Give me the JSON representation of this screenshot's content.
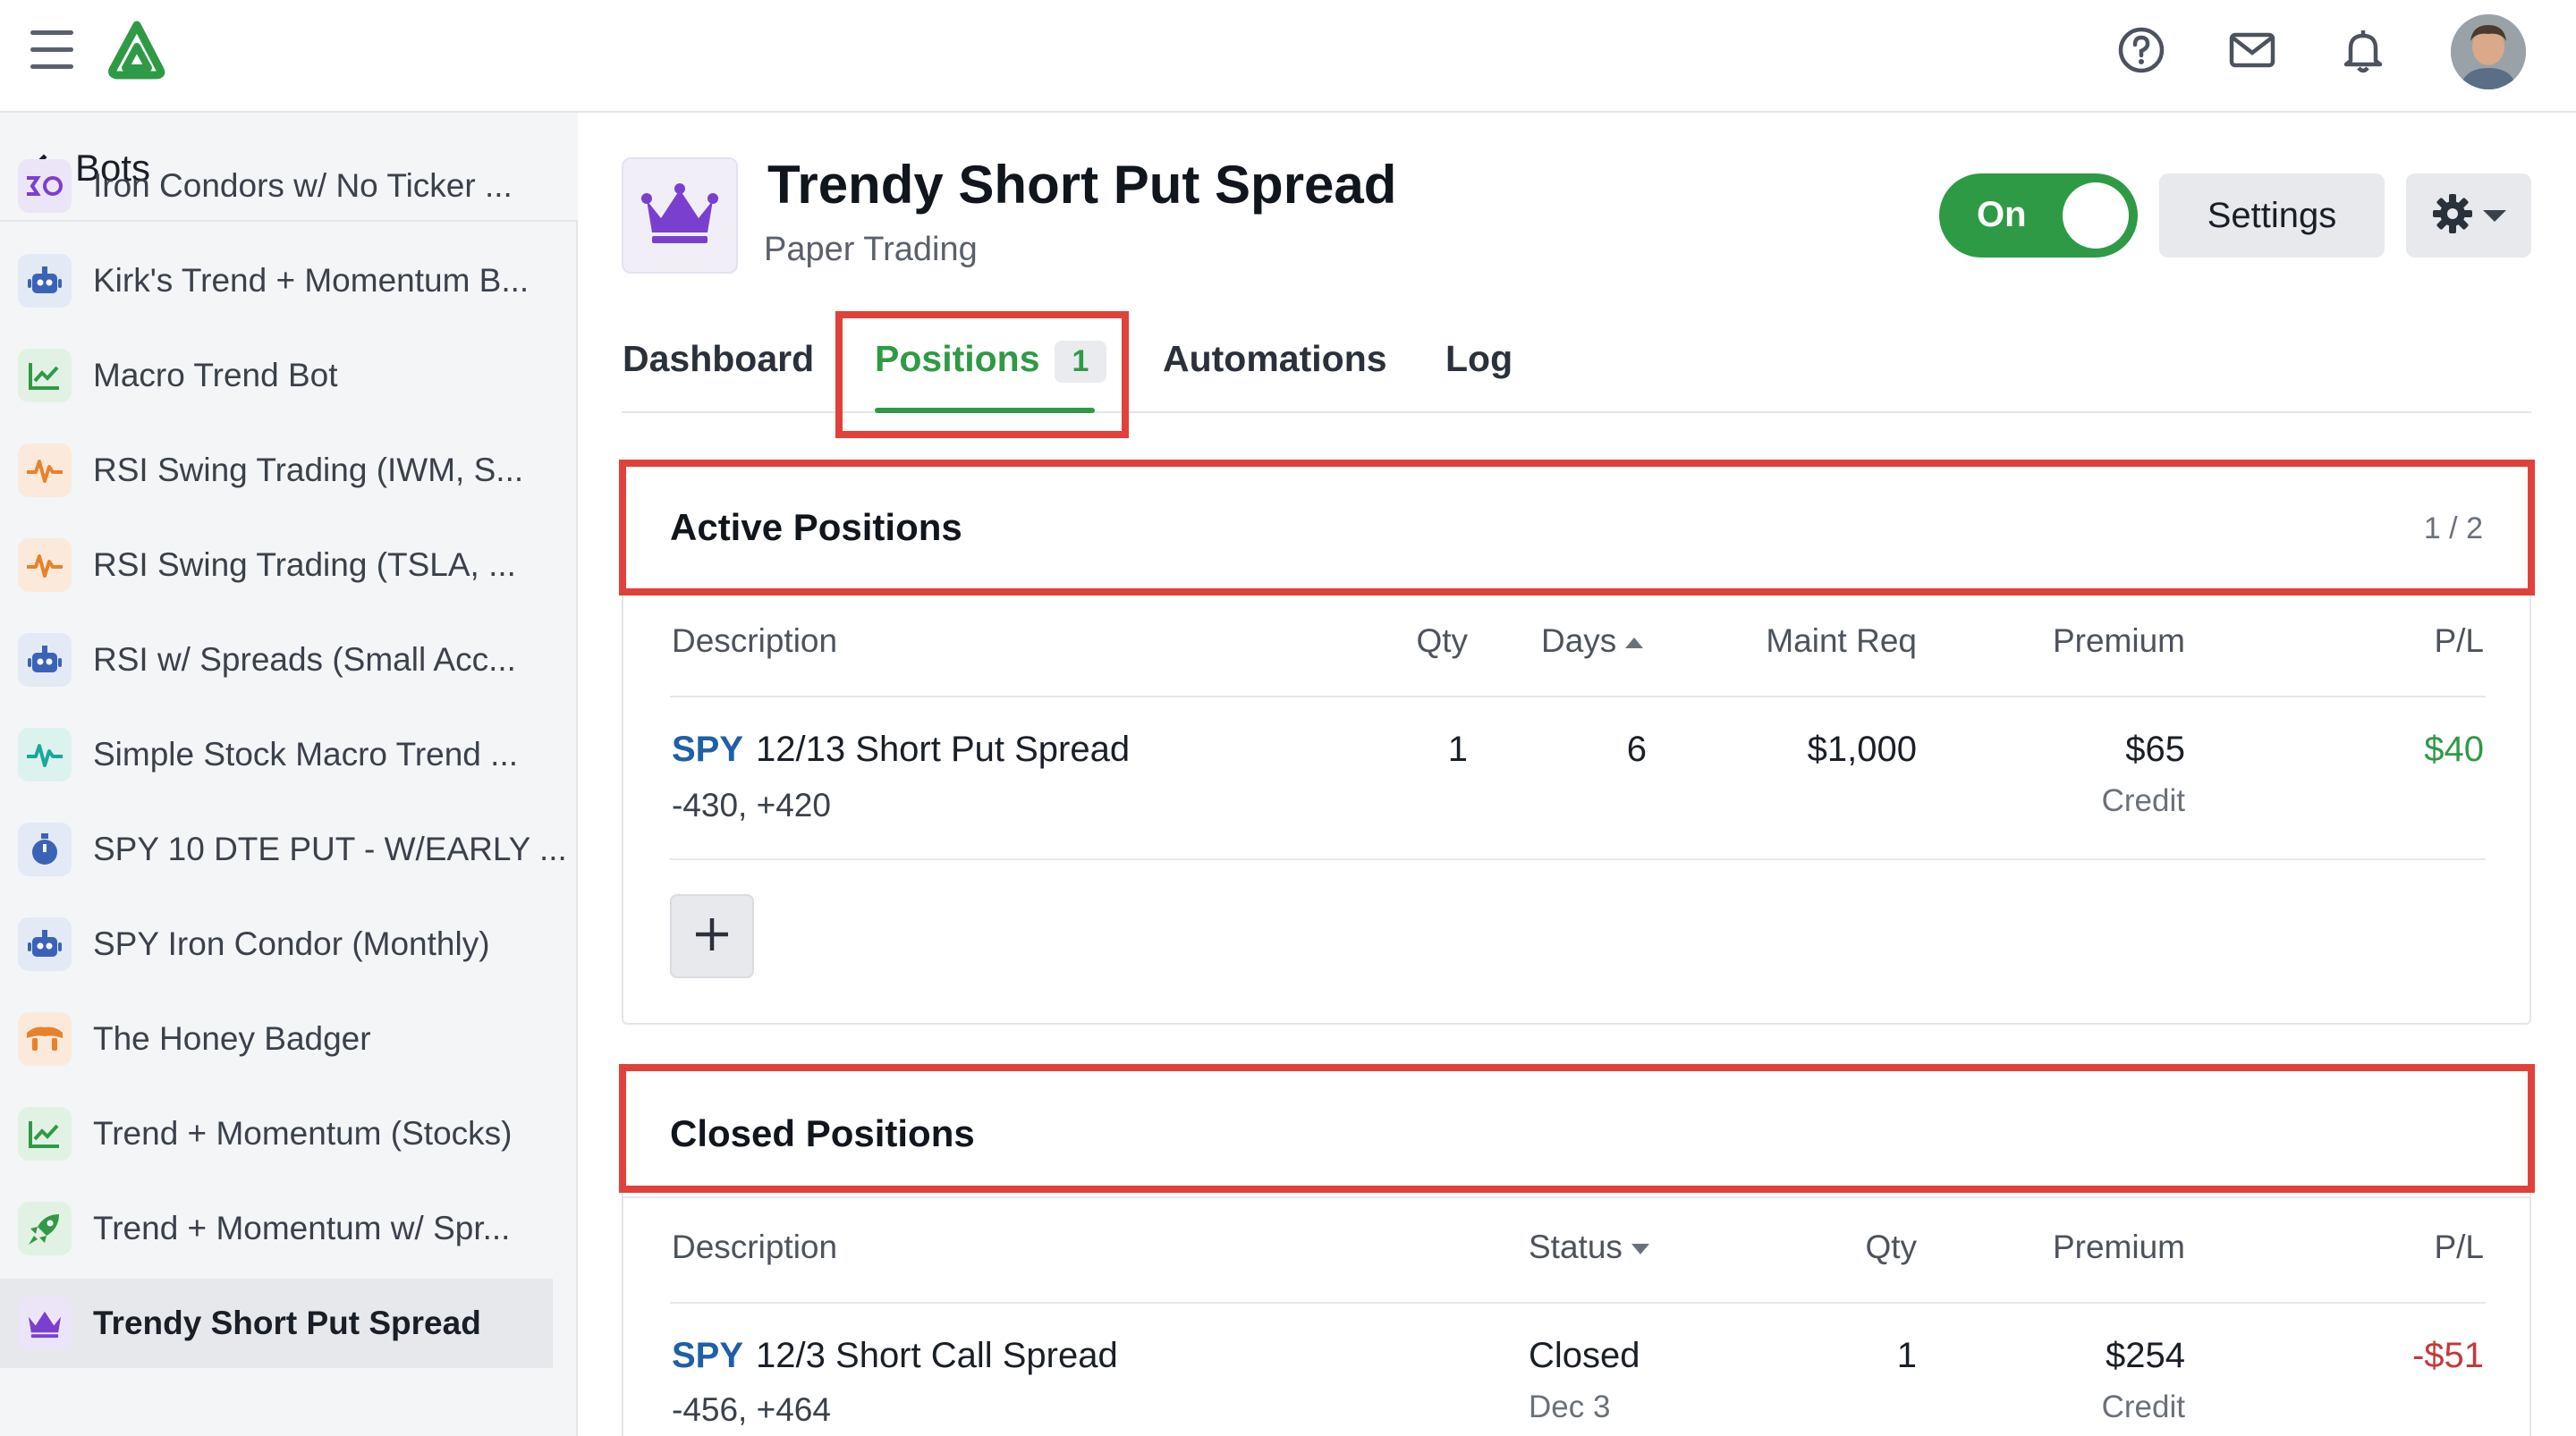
{
  "topbar": {
    "menu_icon": "hamburger-icon",
    "logo_icon": "brand-logo-icon",
    "icons": [
      "help-circle-icon",
      "mail-icon",
      "bell-icon"
    ],
    "avatar_icon": "user-avatar"
  },
  "sidebar": {
    "back_label": "Bots",
    "items": [
      {
        "label": "Iron Condors w/ No Ticker ...",
        "icon": "iron-condor-icon",
        "color": "#7b3fd0"
      },
      {
        "label": "Kirk's Trend + Momentum B...",
        "icon": "robot-icon",
        "color": "#3a63b8"
      },
      {
        "label": "Macro Trend Bot",
        "icon": "chart-line-icon",
        "color": "#2f9a45"
      },
      {
        "label": "RSI Swing Trading (IWM, S...",
        "icon": "pulse-icon",
        "color": "#e8822a"
      },
      {
        "label": "RSI Swing Trading (TSLA, ...",
        "icon": "pulse-icon",
        "color": "#e8822a"
      },
      {
        "label": "RSI w/ Spreads (Small Acc...",
        "icon": "robot-icon",
        "color": "#3a63b8"
      },
      {
        "label": "Simple Stock Macro Trend ...",
        "icon": "pulse-icon",
        "color": "#1aa89a"
      },
      {
        "label": "SPY 10 DTE PUT - W/EARLY ...",
        "icon": "stopwatch-icon",
        "color": "#3a63b8"
      },
      {
        "label": "SPY Iron Condor (Monthly)",
        "icon": "robot-icon",
        "color": "#3a63b8"
      },
      {
        "label": "The Honey Badger",
        "icon": "badger-icon",
        "color": "#e8822a"
      },
      {
        "label": "Trend + Momentum (Stocks)",
        "icon": "chart-line-icon",
        "color": "#2f9a45"
      },
      {
        "label": "Trend + Momentum w/ Spr...",
        "icon": "rocket-icon",
        "color": "#2f9a45"
      },
      {
        "label": "Trendy Short Put Spread",
        "icon": "crown-icon",
        "color": "#7b3fd0",
        "active": true
      }
    ]
  },
  "bot": {
    "title": "Trendy Short Put Spread",
    "subtitle": "Paper Trading",
    "icon": "crown-icon",
    "toggle_label": "On",
    "settings_label": "Settings",
    "gear_icon": "gear-icon"
  },
  "tabs": [
    {
      "label": "Dashboard"
    },
    {
      "label": "Positions",
      "badge": "1",
      "active": true
    },
    {
      "label": "Automations"
    },
    {
      "label": "Log"
    }
  ],
  "active_positions": {
    "title": "Active Positions",
    "count": "1 / 2",
    "columns": {
      "description": "Description",
      "qty": "Qty",
      "days": "Days",
      "maint_req": "Maint Req",
      "premium": "Premium",
      "pl": "P/L"
    },
    "rows": [
      {
        "ticker": "SPY",
        "desc": "12/13 Short Put Spread",
        "legs": "-430, +420",
        "qty": "1",
        "days": "6",
        "maint_req": "$1,000",
        "premium": "$65",
        "premium_type": "Credit",
        "pl": "$40"
      }
    ],
    "add_icon": "plus-icon"
  },
  "closed_positions": {
    "title": "Closed Positions",
    "columns": {
      "description": "Description",
      "status": "Status",
      "qty": "Qty",
      "premium": "Premium",
      "pl": "P/L"
    },
    "rows": [
      {
        "ticker": "SPY",
        "desc": "12/3 Short Call Spread",
        "legs": "-456, +464",
        "status": "Closed",
        "status_date": "Dec 3",
        "qty": "1",
        "premium": "$254",
        "premium_type": "Credit",
        "pl": "-$51"
      }
    ]
  },
  "colors": {
    "accent_green": "#2f9a45",
    "highlight_red": "#e0413a",
    "ticker_blue": "#1f5fa8",
    "loss_red": "#c23a3a"
  }
}
